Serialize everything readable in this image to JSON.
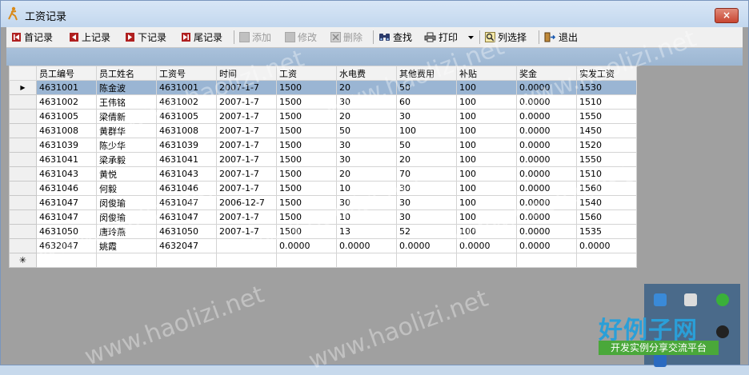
{
  "window": {
    "title": "工资记录",
    "close_label": "×"
  },
  "toolbar": {
    "first": "首记录",
    "prev": "上记录",
    "next": "下记录",
    "last": "尾记录",
    "add": "添加",
    "edit": "修改",
    "delete": "删除",
    "find": "查找",
    "print": "打印",
    "columns": "列选择",
    "exit": "退出"
  },
  "grid": {
    "columns": [
      "员工编号",
      "员工姓名",
      "工资号",
      "时间",
      "工资",
      "水电费",
      "其他费用",
      "补贴",
      "奖金",
      "实发工资"
    ],
    "rows": [
      [
        "4631001",
        "陈金波",
        "4631001",
        "2007-1-7",
        "1500",
        "20",
        "50",
        "100",
        "0.0000",
        "1530"
      ],
      [
        "4631002",
        "王伟铭",
        "4631002",
        "2007-1-7",
        "1500",
        "30",
        "60",
        "100",
        "0.0000",
        "1510"
      ],
      [
        "4631005",
        "梁倩新",
        "4631005",
        "2007-1-7",
        "1500",
        "20",
        "30",
        "100",
        "0.0000",
        "1550"
      ],
      [
        "4631008",
        "黄群华",
        "4631008",
        "2007-1-7",
        "1500",
        "50",
        "100",
        "100",
        "0.0000",
        "1450"
      ],
      [
        "4631039",
        "陈少华",
        "4631039",
        "2007-1-7",
        "1500",
        "30",
        "50",
        "100",
        "0.0000",
        "1520"
      ],
      [
        "4631041",
        "梁承毅",
        "4631041",
        "2007-1-7",
        "1500",
        "30",
        "20",
        "100",
        "0.0000",
        "1550"
      ],
      [
        "4631043",
        "黄悦",
        "4631043",
        "2007-1-7",
        "1500",
        "20",
        "70",
        "100",
        "0.0000",
        "1510"
      ],
      [
        "4631046",
        "何毅",
        "4631046",
        "2007-1-7",
        "1500",
        "10",
        "30",
        "100",
        "0.0000",
        "1560"
      ],
      [
        "4631047",
        "闵俊瑜",
        "4631047",
        "2006-12-7",
        "1500",
        "30",
        "30",
        "100",
        "0.0000",
        "1540"
      ],
      [
        "4631047",
        "闵俊瑜",
        "4631047",
        "2007-1-7",
        "1500",
        "10",
        "30",
        "100",
        "0.0000",
        "1560"
      ],
      [
        "4631050",
        "唐玲燕",
        "4631050",
        "2007-1-7",
        "1500",
        "13",
        "52",
        "100",
        "0.0000",
        "1535"
      ],
      [
        "4632047",
        "姚霞",
        "4632047",
        "",
        "0.0000",
        "0.0000",
        "0.0000",
        "0.0000",
        "0.0000",
        "0.0000"
      ]
    ],
    "selected_marker": "▶",
    "new_row_marker": "✳"
  },
  "watermark": {
    "text": "www.haolizi.net"
  },
  "brand": {
    "title": "好例子网",
    "subtitle": "开发实例分享交流平台"
  }
}
